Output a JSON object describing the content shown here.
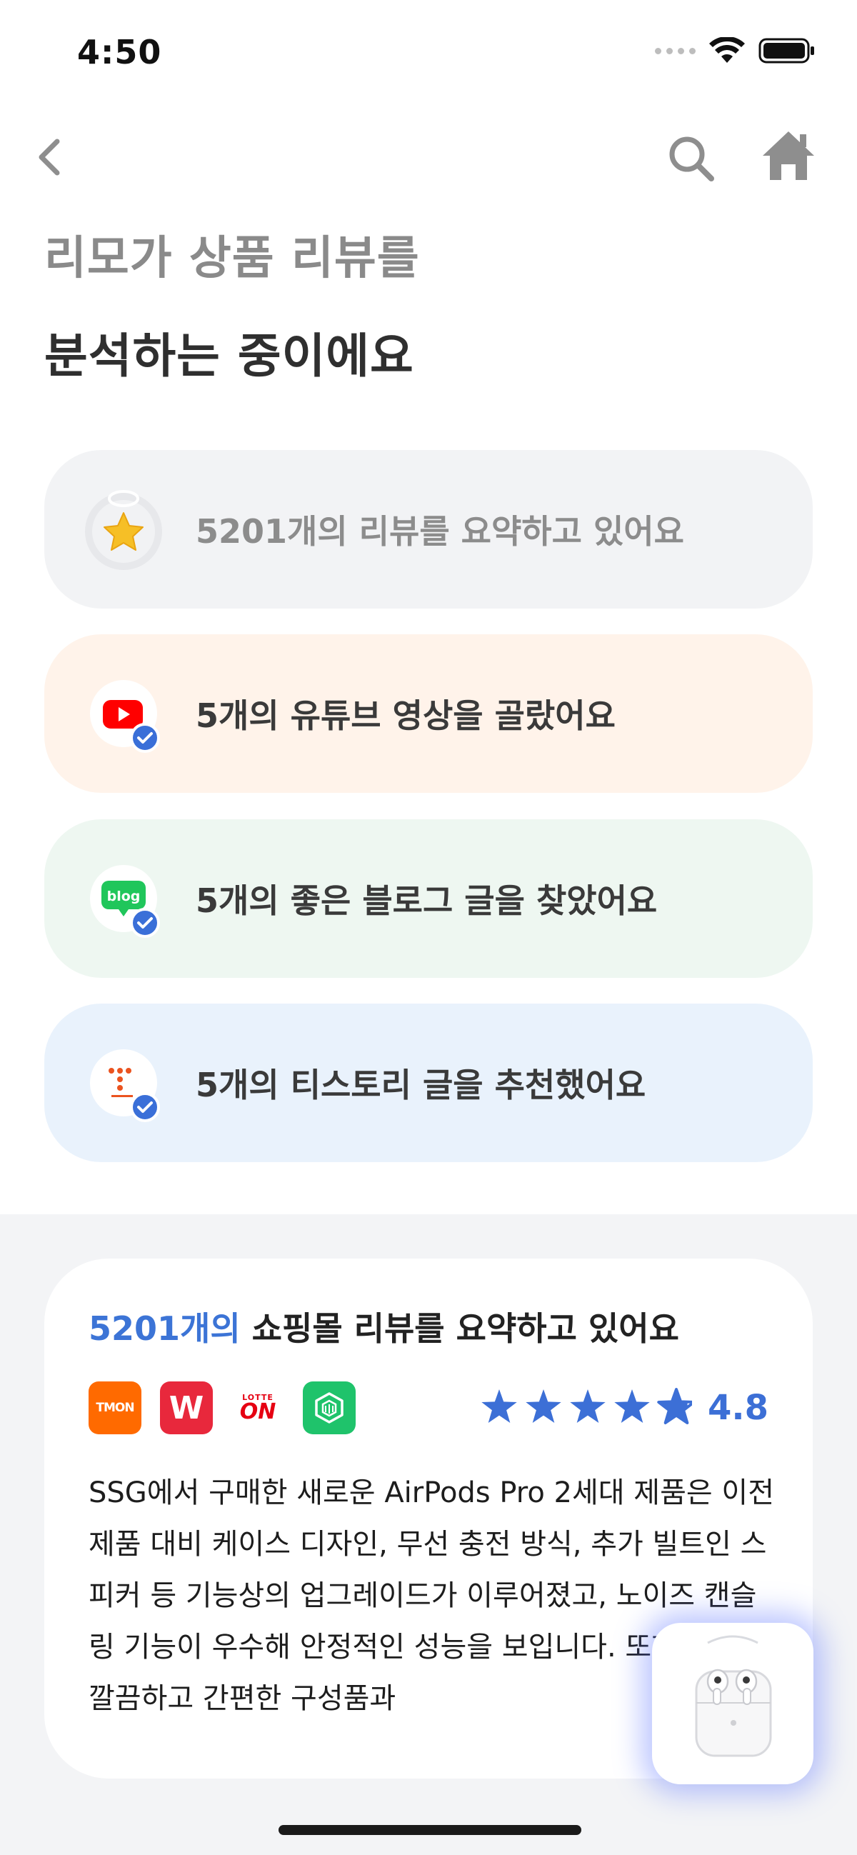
{
  "status_bar": {
    "time": "4:50"
  },
  "nav": {
    "back_icon": "chevron-left-icon",
    "search_icon": "search-icon",
    "home_icon": "home-icon"
  },
  "heading": {
    "line1": "리모가 상품 리뷰를",
    "line2": "분석하는 중이에요"
  },
  "steps": [
    {
      "label": "5201개의 리뷰를 요약하고 있어요",
      "icon": "star-icon",
      "state": "in-progress"
    },
    {
      "label": "5개의 유튜브 영상을 골랐어요",
      "icon": "youtube-icon",
      "state": "done"
    },
    {
      "label": "5개의 좋은 블로그 글을 찾았어요",
      "icon": "blog-icon",
      "state": "done"
    },
    {
      "label": "5개의 티스토리 글을 추천했어요",
      "icon": "tistory-icon",
      "state": "done"
    }
  ],
  "summary": {
    "title_accent": "5201개의",
    "title_rest": " 쇼핑몰 리뷰를 요약하고 있어요",
    "malls": [
      {
        "name": "tmon",
        "label": "TMON"
      },
      {
        "name": "wemakeprice",
        "label": "W"
      },
      {
        "name": "lotteon",
        "label_small": "LOTTE",
        "label_big": "ON"
      },
      {
        "name": "naver-store",
        "label": ""
      }
    ],
    "rating": 4.8,
    "rating_text": "4.8",
    "text": "SSG에서 구매한 새로운 AirPods Pro 2세대 제품은 이전 제품 대비 케이스 디자인, 무선 충전 방식, 추가 빌트인 스피커 등 기능상의 업그레이드가 이루어졌고, 노이즈 캔슬링 기능이 우수해 안정적인 성능을 보입니다. 또한 애플의 깔끔하고 간편한 구성품과"
  },
  "colors": {
    "accent": "#3c74d6",
    "step_gray": "#f2f3f5",
    "step_orange": "#fff3ea",
    "step_green": "#eef7f1",
    "step_blue": "#e9f2fc",
    "star": "#3c6fd6"
  }
}
